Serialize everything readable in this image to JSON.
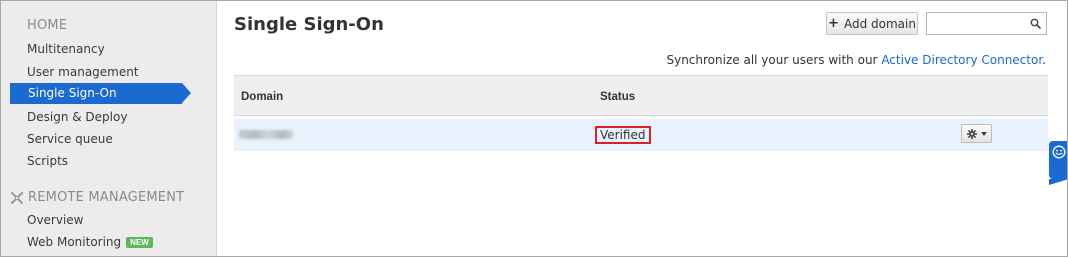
{
  "sidebar": {
    "home_heading": "HOME",
    "items": [
      {
        "label": "Multitenancy"
      },
      {
        "label": "User management"
      },
      {
        "label": "Single Sign-On",
        "active": true
      },
      {
        "label": "Design & Deploy"
      },
      {
        "label": "Service queue"
      },
      {
        "label": "Scripts"
      }
    ],
    "remote_heading": "REMOTE MANAGEMENT",
    "remote_icon": "tools-icon",
    "remote_items": [
      {
        "label": "Overview"
      },
      {
        "label": "Web Monitoring",
        "badge": "NEW"
      }
    ]
  },
  "header": {
    "title": "Single Sign-On",
    "add_domain_label": "Add domain",
    "search_placeholder": "",
    "search_value": ""
  },
  "sync": {
    "text": "Synchronize all your users with our ",
    "link": "Active Directory Connector",
    "suffix": "."
  },
  "table": {
    "columns": [
      "Domain",
      "Status"
    ],
    "rows": [
      {
        "domain": "",
        "status": "Verified"
      }
    ]
  },
  "colors": {
    "accent": "#1a6ad0",
    "badge_green": "#5cb85c",
    "highlight_red": "#e01f26",
    "row_bg": "#e8f2fc"
  }
}
